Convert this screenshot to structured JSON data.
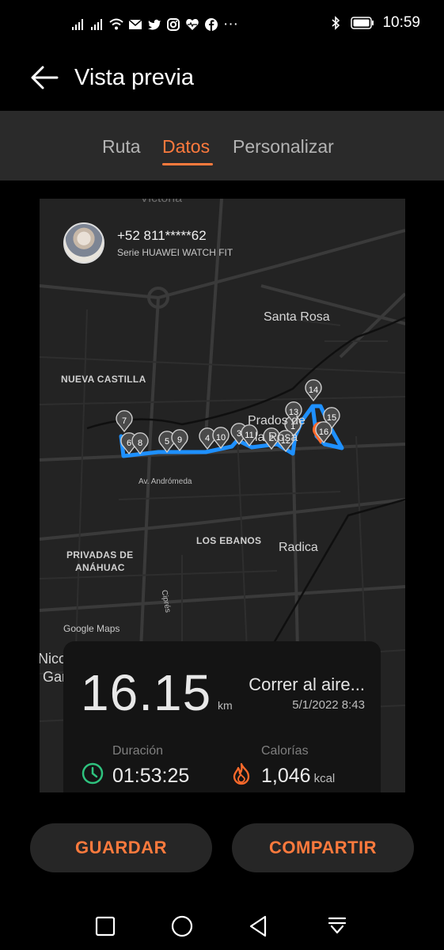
{
  "status_bar": {
    "time": "10:59",
    "left_icons": [
      "signal-icon",
      "signal-icon",
      "wifi-icon",
      "mail-icon",
      "twitter-icon",
      "instagram-icon",
      "health-icon",
      "facebook-icon",
      "more-icon"
    ],
    "right_icons": [
      "bluetooth-icon",
      "battery-icon"
    ],
    "more": "···"
  },
  "header": {
    "title": "Vista previa"
  },
  "tabs": [
    {
      "label": "Ruta",
      "active": false
    },
    {
      "label": "Datos",
      "active": true
    },
    {
      "label": "Personalizar",
      "active": false
    }
  ],
  "user": {
    "phone": "+52 811*****62",
    "device": "Serie HUAWEI WATCH FIT"
  },
  "map": {
    "labels": {
      "victoria": "Victoria",
      "santa_rosa": "Santa Rosa",
      "nueva_castilla": "NUEVA CASTILLA",
      "prados": "Prados de",
      "la_rosa": "la Rosa",
      "andromeda": "Av. Andrómeda",
      "los_ebanos": "LOS EBANOS",
      "radica": "Radica",
      "privadas": "PRIVADAS DE",
      "anahuac": "ANÁHUAC",
      "cipres": "Ciprés",
      "nicol": "Nicol",
      "gar": "Gar"
    },
    "attribution": "Google Maps",
    "markers": [
      "1",
      "2",
      "3",
      "4",
      "5",
      "6",
      "7",
      "8",
      "9",
      "10",
      "11",
      "12",
      "13",
      "14",
      "15",
      "16"
    ],
    "route_color": "#1e90ff"
  },
  "stats": {
    "distance": "16.15",
    "distance_unit": "km",
    "activity": "Correr al aire...",
    "datetime": "5/1/2022 8:43",
    "duration_label": "Duración",
    "duration_value": "01:53:25",
    "calories_label": "Calorías",
    "calories_value": "1,046",
    "calories_unit": "kcal"
  },
  "actions": {
    "save": "GUARDAR",
    "share": "COMPARTIR"
  },
  "colors": {
    "accent": "#ff7a3d",
    "duration_icon": "#2ec27e",
    "calories_icon": "#ff6a2b"
  }
}
